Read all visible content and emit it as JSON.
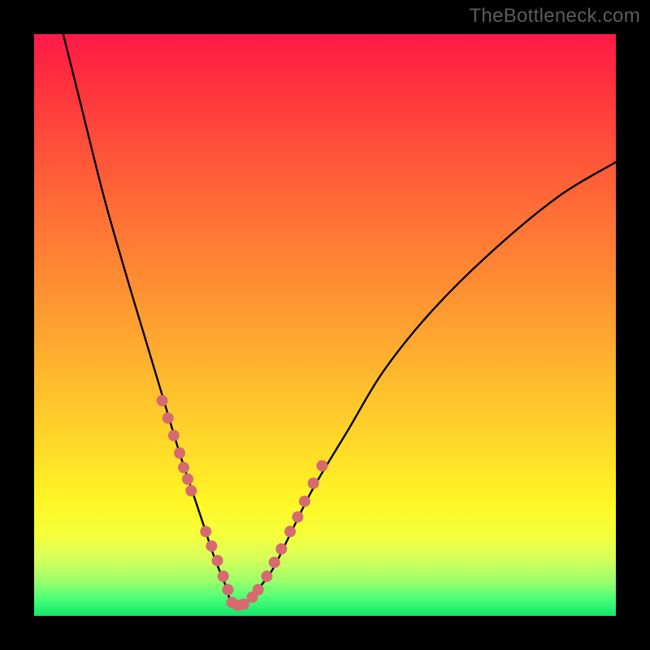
{
  "watermark": "TheBottleneck.com",
  "colors": {
    "frame_bg": "#000000",
    "gradient_top": "#ff1a47",
    "gradient_bottom": "#12e66a",
    "curve": "#000000",
    "dots": "#d66a6f",
    "watermark": "#5c5c5c"
  },
  "chart_data": {
    "type": "line",
    "title": "",
    "xlabel": "",
    "ylabel": "",
    "xlim": [
      0,
      100
    ],
    "ylim": [
      0,
      100
    ],
    "grid": false,
    "legend": false,
    "note": "Values are percentages of plot area; (0,0) is bottom-left. Bottleneck-style curve: steep fall from top-left to a trough near x≈34, then rise toward upper-right.",
    "series": [
      {
        "name": "curve",
        "x": [
          5,
          8,
          12,
          16,
          19,
          22,
          25,
          27,
          29,
          31,
          33,
          34,
          36,
          38,
          41,
          44,
          48,
          54,
          60,
          68,
          78,
          90,
          100
        ],
        "y": [
          100,
          88,
          72,
          58,
          48,
          38,
          28,
          22,
          16,
          10,
          5,
          2,
          2,
          4,
          8,
          14,
          22,
          32,
          42,
          52,
          62,
          72,
          78
        ]
      },
      {
        "name": "highlight-dots",
        "x": [
          22,
          23,
          24,
          25,
          25.7,
          26.4,
          27,
          29.5,
          30.5,
          31.5,
          32.5,
          33.3,
          34,
          35,
          36,
          37.5,
          38.5,
          40,
          41.3,
          42.5,
          44,
          45.3,
          46.5,
          48,
          49.5
        ],
        "y": [
          37,
          34,
          31,
          28,
          25.5,
          23.5,
          21.5,
          14.5,
          12,
          9.5,
          6.8,
          4.5,
          2.3,
          1.8,
          2,
          3.2,
          4.5,
          6.8,
          9.2,
          11.5,
          14.5,
          17,
          19.7,
          22.8,
          25.8
        ]
      }
    ]
  }
}
